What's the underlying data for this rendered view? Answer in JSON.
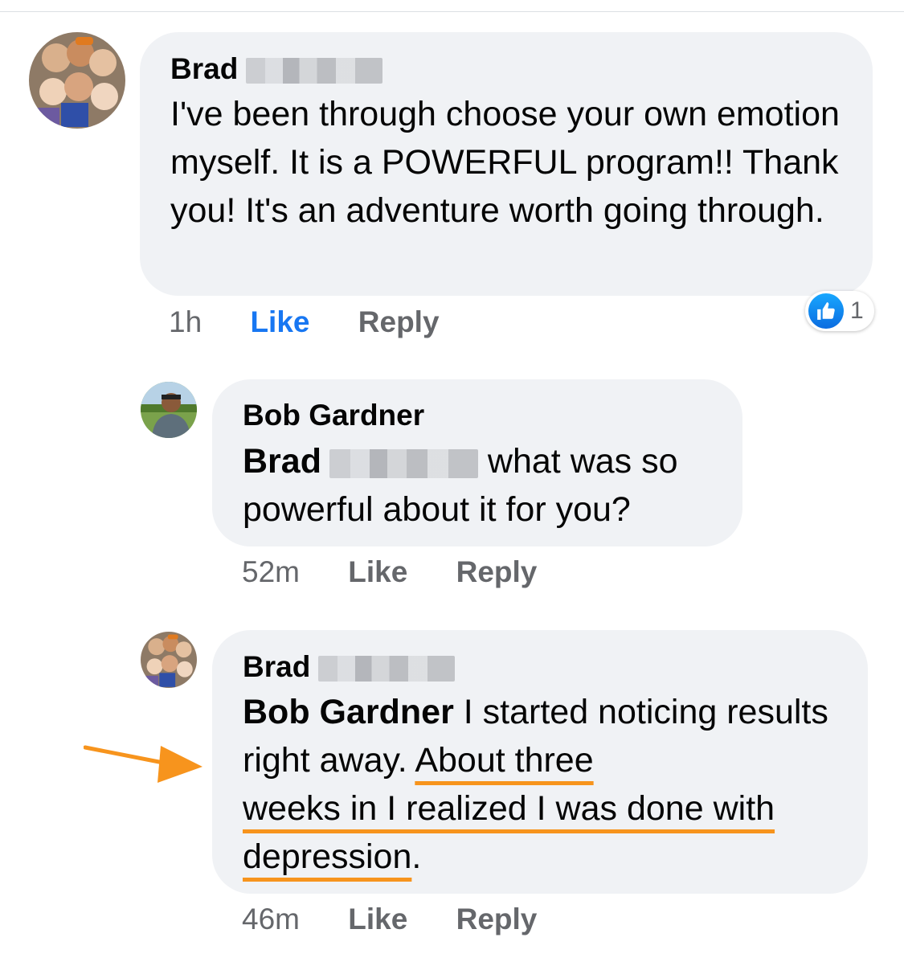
{
  "comments": [
    {
      "author_first": "Brad",
      "text": "I've been through choose your own emotion myself. It is a POWERFUL program!! Thank you! It's an adventure worth going through.",
      "time": "1h",
      "like_label": "Like",
      "reply_label": "Reply",
      "liked": true,
      "reaction_count": "1",
      "reaction_icon": "thumbs-up-icon"
    },
    {
      "author": "Bob Gardner",
      "mention": "Brad",
      "text": "what was so powerful about it for you?",
      "time": "52m",
      "like_label": "Like",
      "reply_label": "Reply"
    },
    {
      "author_first": "Brad",
      "mention": "Bob Gardner",
      "text_plain": " I started noticing results right away. ",
      "text_highlight_1": "About three",
      "text_highlight_2": "weeks in I realized I was done with",
      "text_highlight_3": "depression",
      "text_end": ".",
      "time": "46m",
      "like_label": "Like",
      "reply_label": "Reply"
    }
  ],
  "colors": {
    "bubble": "#f0f2f5",
    "like_active": "#1877f2",
    "meta": "#65676b",
    "annotation": "#f7941d"
  },
  "annotation": {
    "icon": "arrow-right-icon"
  }
}
